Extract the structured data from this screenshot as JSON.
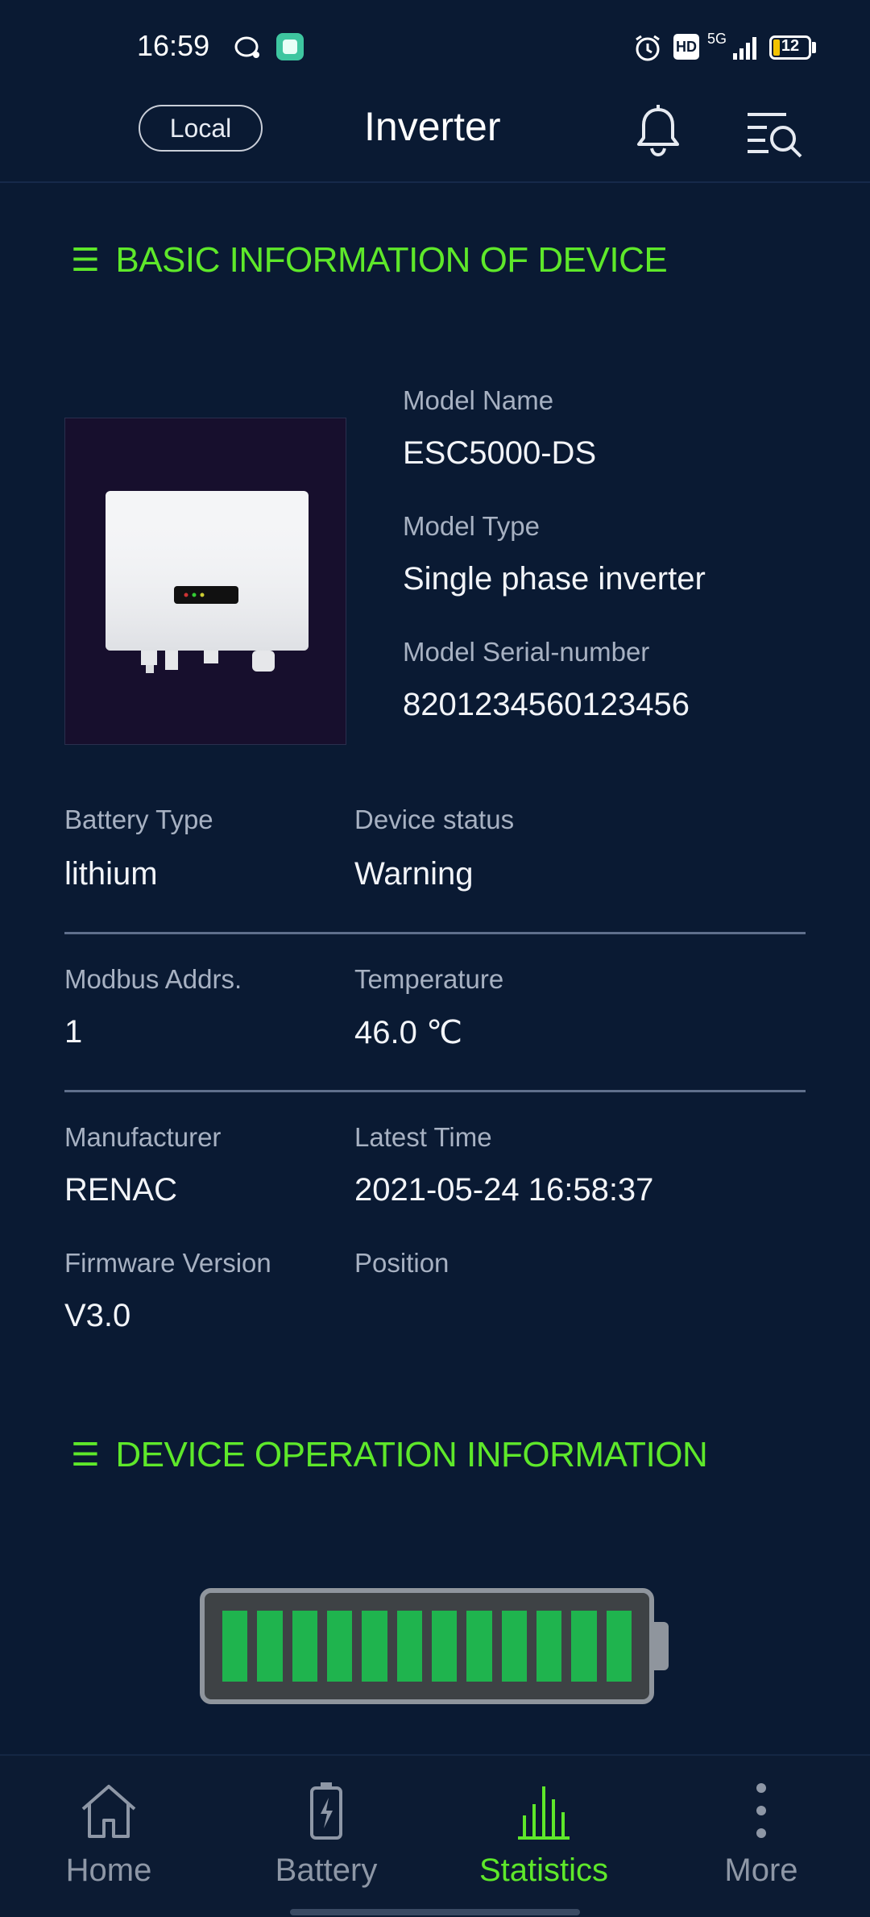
{
  "status_bar": {
    "time": "16:59",
    "network": "5G",
    "hd": "HD",
    "battery_level": "12"
  },
  "header": {
    "local_label": "Local",
    "title": "Inverter"
  },
  "sections": {
    "basic_info_title": "BASIC INFORMATION OF DEVICE",
    "operation_info_title": "DEVICE OPERATION INFORMATION"
  },
  "device": {
    "model_name_label": "Model Name",
    "model_name": "ESC5000-DS",
    "model_type_label": "Model Type",
    "model_type": "Single phase inverter",
    "serial_label": "Model Serial-number",
    "serial": "8201234560123456",
    "battery_type_label": "Battery Type",
    "battery_type": "lithium",
    "status_label": "Device status",
    "status": "Warning",
    "modbus_label": "Modbus Addrs.",
    "modbus": "1",
    "temperature_label": "Temperature",
    "temperature": "46.0 ℃",
    "manufacturer_label": "Manufacturer",
    "manufacturer": "RENAC",
    "latest_time_label": "Latest Time",
    "latest_time": "2021-05-24 16:58:37",
    "firmware_label": "Firmware Version",
    "firmware": "V3.0",
    "position_label": "Position",
    "position": ""
  },
  "battery_graphic": {
    "filled_cells": 12,
    "total_cells": 12,
    "fill_color": "#1fb44e"
  },
  "nav": {
    "items": [
      {
        "label": "Home",
        "icon": "home-icon"
      },
      {
        "label": "Battery",
        "icon": "battery-icon"
      },
      {
        "label": "Statistics",
        "icon": "bar-chart-icon"
      },
      {
        "label": "More",
        "icon": "more-icon"
      }
    ],
    "active": "Statistics"
  },
  "colors": {
    "accent": "#5ee82a",
    "background": "#0a1a33"
  }
}
